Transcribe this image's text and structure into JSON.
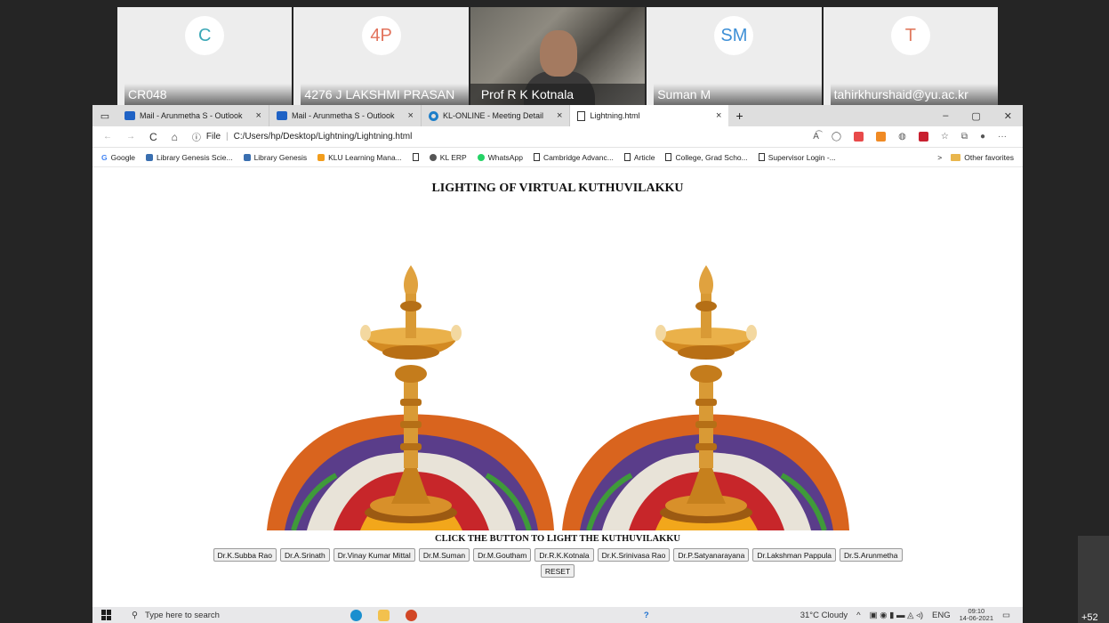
{
  "participants": [
    {
      "initials": "C",
      "name": "CR048",
      "color": "#3aa7b6"
    },
    {
      "initials": "4P",
      "name": "4276 J LAKSHMI PRASAN",
      "color": "#e2725b"
    },
    {
      "initials": "",
      "name": "Prof R K Kotnala",
      "color": ""
    },
    {
      "initials": "SM",
      "name": "Suman M",
      "color": "#3d8fd6"
    },
    {
      "initials": "T",
      "name": "tahirkhurshaid@yu.ac.kr",
      "color": "#e07a5f"
    }
  ],
  "tabs": [
    {
      "label": "Mail - Arunmetha S - Outlook",
      "close": "×"
    },
    {
      "label": "Mail - Arunmetha S - Outlook",
      "close": "×"
    },
    {
      "label": "KL-ONLINE - Meeting Detail",
      "close": "×"
    },
    {
      "label": "Lightning.html",
      "close": "×"
    }
  ],
  "new_tab": "+",
  "window_controls": {
    "minimize": "–",
    "maximize": "▢",
    "close": "✕"
  },
  "address": {
    "info": "ⓘ",
    "scheme": "File",
    "separator": "|",
    "path": "C:/Users/hp/Desktop/Lightning/Lightning.html"
  },
  "nav": {
    "back": "←",
    "forward": "→",
    "reload": "C",
    "home": "⌂"
  },
  "favorites": [
    {
      "label": "Google",
      "color": "#4285f4"
    },
    {
      "label": "Library Genesis Scie...",
      "color": "#3a6fb0"
    },
    {
      "label": "Library Genesis",
      "color": "#3a6fb0"
    },
    {
      "label": "KLU Learning Mana...",
      "color": "#f29d1c"
    },
    {
      "label": "",
      "color": "#777777"
    },
    {
      "label": "KL ERP",
      "color": "#555555"
    },
    {
      "label": "WhatsApp",
      "color": "#25d366"
    },
    {
      "label": "Cambridge Advanc...",
      "color": "#777777"
    },
    {
      "label": "Article",
      "color": "#777777"
    },
    {
      "label": "College, Grad Scho...",
      "color": "#777777"
    },
    {
      "label": "Supervisor Login -...",
      "color": "#777777"
    }
  ],
  "favorites_more": ">",
  "other_favorites": "Other favorites",
  "page": {
    "title": "LIGHTING OF VIRTUAL KUTHUVILAKKU",
    "instruction": "CLICK THE BUTTON TO LIGHT THE KUTHUVILAKKU",
    "buttons": [
      "Dr.K.Subba Rao",
      "Dr.A.Srinath",
      "Dr.Vinay Kumar Mittal",
      "Dr.M.Suman",
      "Dr.M.Goutham",
      "Dr.R.K.Kotnala",
      "Dr.K.Srinivasa Rao",
      "Dr.P.Satyanarayana",
      "Dr.Lakshman Pappula",
      "Dr.S.Arunmetha"
    ],
    "reset": "RESET"
  },
  "taskbar": {
    "search_placeholder": "Type here to search",
    "search_icon": "⚲",
    "weather": "31°C  Cloudy",
    "lang": "ENG",
    "time": "09:10",
    "date": "14-06-2021",
    "help": "?"
  },
  "overflow_count": "+52"
}
